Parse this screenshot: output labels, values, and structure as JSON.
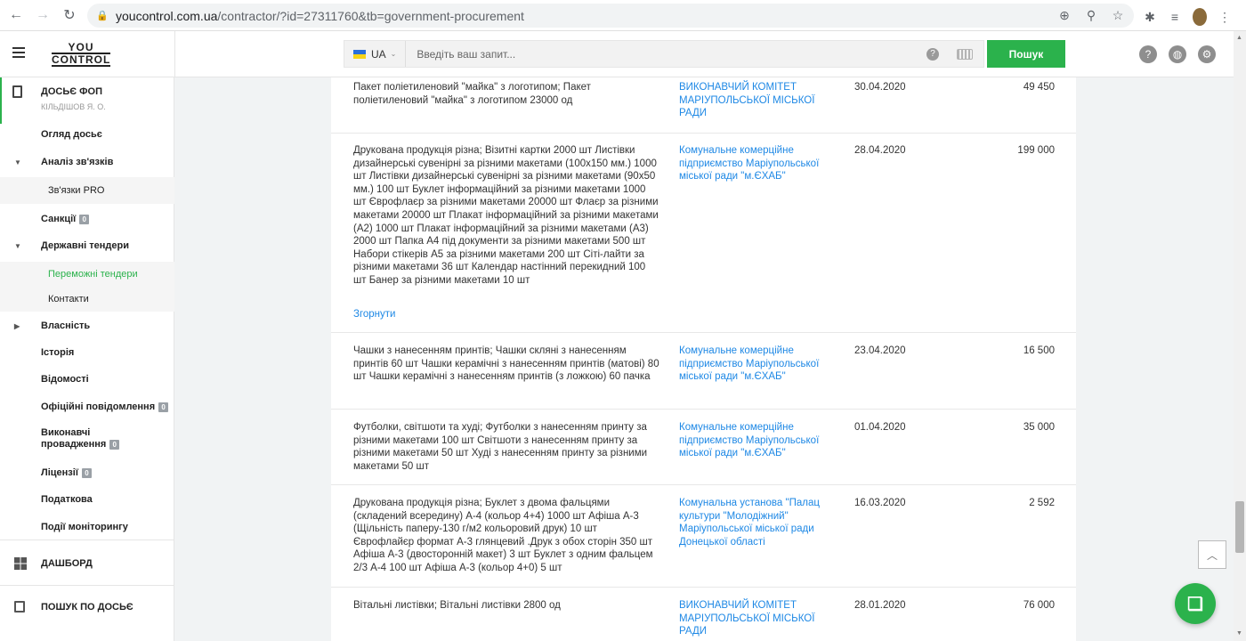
{
  "browser": {
    "url_host": "youcontrol.com.ua",
    "url_path": "/contractor/?id=27311760&tb=government-procurement"
  },
  "header": {
    "logo_line1": "YOU",
    "logo_line2": "CONTROL",
    "lang": "UA",
    "search_placeholder": "Введіть ваш запит...",
    "search_button": "Пошук",
    "accent_color": "#2bb24c"
  },
  "sidebar": {
    "dossier_title": "ДОСЬЄ ФОП",
    "dossier_sub": "КІЛЬДІШОВ Я. О.",
    "items": [
      {
        "label": "Огляд досьє"
      },
      {
        "label": "Аналіз зв'язків"
      },
      {
        "label": "Зв'язки PRO"
      },
      {
        "label": "Санкції",
        "badge": "0"
      },
      {
        "label": "Державні тендери"
      },
      {
        "label": "Переможні тендери"
      },
      {
        "label": "Контакти"
      },
      {
        "label": "Власність"
      },
      {
        "label": "Історія"
      },
      {
        "label": "Відомості"
      },
      {
        "label": "Офіційні повідомлення",
        "badge": "0"
      },
      {
        "label": "Виконавчі провадження",
        "badge": "0"
      },
      {
        "label": "Ліцензії",
        "badge": "0"
      },
      {
        "label": "Податкова"
      },
      {
        "label": "Події моніторингу"
      }
    ],
    "dashboard": "ДАШБОРД",
    "dossier_search": "ПОШУК ПО ДОСЬЄ"
  },
  "tenders": {
    "collapse_label": "Згорнути",
    "rows": [
      {
        "desc": "Пакет поліетиленовий \"майка\" з логотипом; Пакет поліетиленовий \"майка\" з логотипом 23000 од",
        "org": "ВИКОНАВЧИЙ КОМІТЕТ МАРІУПОЛЬСЬКОЇ МІСЬКОЇ РАДИ",
        "date": "30.04.2020",
        "sum": "49 450"
      },
      {
        "desc": "Друкована продукція різна; Візитні картки 2000 шт Листівки дизайнерські сувенірні за різними макетами (100x150 мм.) 1000 шт Листівки дизайнерські сувенірні за різними макетами (90x50 мм.) 100 шт Буклет інформаційний за різними макетами 1000 шт Єврофлаєр за різними макетами 20000 шт Флаєр за різними макетами 20000 шт Плакат інформаційний за різними макетами (А2) 1000 шт Плакат інформаційний за різними макетами (А3) 2000 шт Папка А4 під документи за різними макетами 500 шт Набори стікерів А5 за різними макетами 200 шт Сіті-лайти за різними макетами 36 шт Календар настінний перекидний 100 шт Банер за різними макетами 10 шт",
        "org": "Комунальне комерційне підприємство Маріупольської міської ради \"м.ЄХАБ\"",
        "date": "28.04.2020",
        "sum": "199 000"
      },
      {
        "desc": "Чашки з нанесенням принтів; Чашки скляні з нанесенням принтів 60 шт Чашки керамічні з нанесенням принтів (матові) 80 шт Чашки керамічні з нанесенням принтів (з ложкою) 60 пачка",
        "org": "Комунальне комерційне підприємство Маріупольської міської ради \"м.ЄХАБ\"",
        "date": "23.04.2020",
        "sum": "16 500"
      },
      {
        "desc": "Футболки, світшоти та худі; Футболки з нанесенням принту за різними макетами 100 шт Світшоти з нанесенням принту за різними макетами 50 шт Худі з нанесенням принту за різними макетами 50 шт",
        "org": "Комунальне комерційне підприємство Маріупольської міської ради \"м.ЄХАБ\"",
        "date": "01.04.2020",
        "sum": "35 000"
      },
      {
        "desc": "Друкована продукція різна; Буклет з двома фальцями (складений всередину) А-4 (кольор 4+4) 1000 шт Афіша А-3 (Щільність паперу-130 г/м2 кольоровий друк) 10 шт Єврофлайєр формат А-3 глянцевий .Друк з обох сторін 350 шт Афіша А-3 (двосторонній макет) 3 шт Буклет з одним фальцем 2/3 А-4 100 шт Афіша А-3 (кольор 4+0) 5 шт",
        "org": "Комунальна установа \"Палац культури \"Молодіжний\" Маріупольської міської ради Донецької області",
        "date": "16.03.2020",
        "sum": "2 592"
      },
      {
        "desc": "Вітальні листівки; Вітальні листівки 2800 од",
        "org": "ВИКОНАВЧИЙ КОМІТЕТ МАРІУПОЛЬСЬКОЇ МІСЬКОЇ РАДИ",
        "date": "28.01.2020",
        "sum": "76 000"
      }
    ]
  }
}
